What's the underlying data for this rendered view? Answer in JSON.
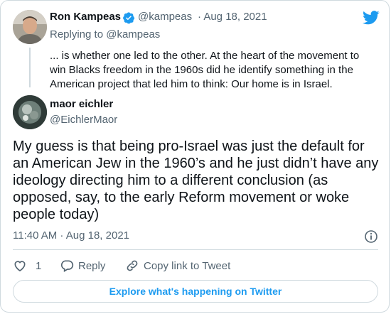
{
  "quoted_tweet": {
    "author_name": "Ron Kampeas",
    "author_handle": "@kampeas",
    "date": "· Aug 18, 2021",
    "replying_to": "Replying to @kampeas",
    "text": "... is whether one led to the other. At the heart of the movement to win Blacks freedom in the 1960s did he identify something in the American project that led him to think: Our home is in Israel."
  },
  "tweet": {
    "author_name": "maor eichler",
    "author_handle": "@EichlerMaor",
    "text": "My guess is that being pro-Israel was just the default for an American Jew in the 1960’s and he just didn’t have any ideology directing him to a different conclusion (as opposed, say, to the early Reform movement or woke people today)",
    "timestamp": "11:40 AM · Aug 18, 2021"
  },
  "actions": {
    "like_count": "1",
    "reply_label": "Reply",
    "copy_link_label": "Copy link to Tweet"
  },
  "explore_label": "Explore what's happening on Twitter",
  "colors": {
    "brand": "#1d9bf0",
    "text": "#0f1419",
    "secondary": "#536471",
    "border": "#cfd9de"
  }
}
